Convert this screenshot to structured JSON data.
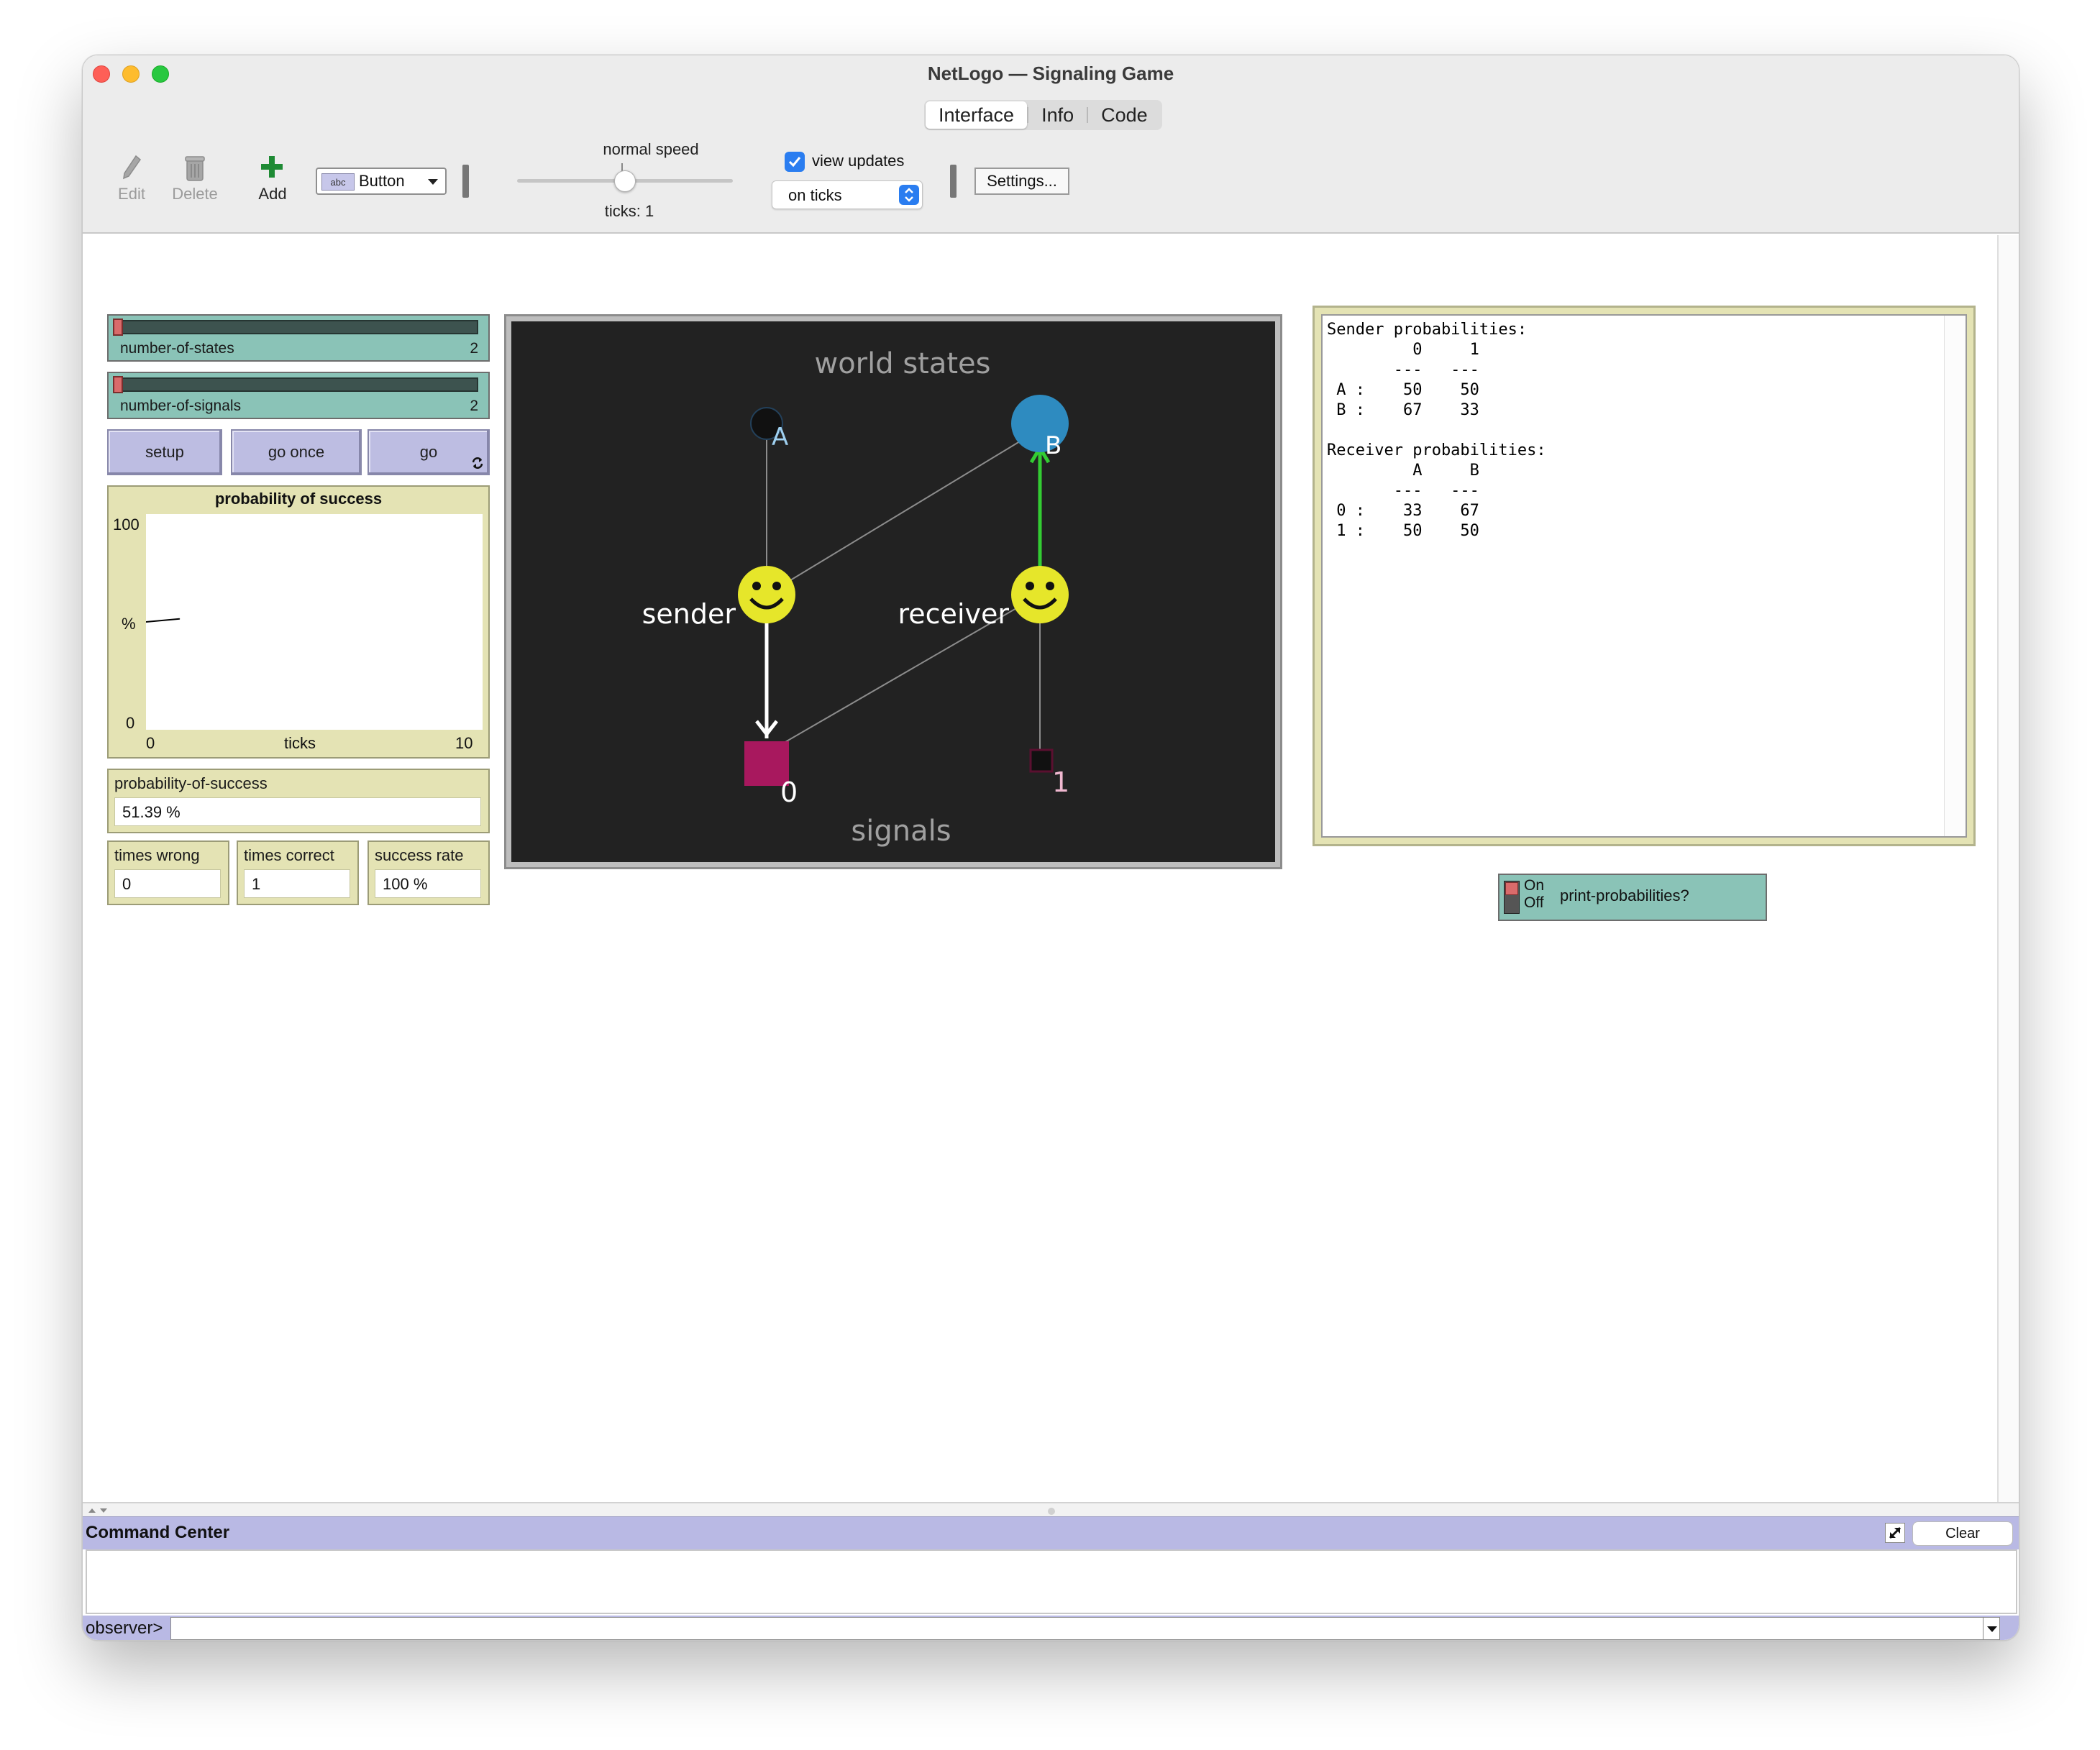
{
  "window": {
    "title": "NetLogo — Signaling Game"
  },
  "tabs": [
    {
      "label": "Interface",
      "active": true
    },
    {
      "label": "Info",
      "active": false
    },
    {
      "label": "Code",
      "active": false
    }
  ],
  "toolbar": {
    "edit": "Edit",
    "delete": "Delete",
    "add": "Add",
    "widget_select": "Button",
    "speed_label": "normal speed",
    "speed_level": 0.5,
    "ticks_text": "ticks: 1",
    "view_updates_label": "view updates",
    "view_updates_checked": true,
    "update_mode": "on ticks",
    "settings": "Settings..."
  },
  "sliders": [
    {
      "label": "number-of-states",
      "value": "2"
    },
    {
      "label": "number-of-signals",
      "value": "2"
    }
  ],
  "buttons": {
    "setup": "setup",
    "go_once": "go once",
    "go": "go"
  },
  "plot": {
    "title": "probability of success",
    "y_max": "100",
    "y_min": "0",
    "y_label": "%",
    "x_min": "0",
    "x_max": "10",
    "x_label": "ticks"
  },
  "chart_data": {
    "type": "line",
    "title": "probability of success",
    "xlabel": "ticks",
    "ylabel": "%",
    "xlim": [
      0,
      10
    ],
    "ylim": [
      0,
      100
    ],
    "x": [
      0,
      1
    ],
    "y": [
      50,
      51.39
    ]
  },
  "monitors": {
    "probability": {
      "label": "probability-of-success",
      "value": "51.39 %"
    },
    "times_wrong": {
      "label": "times wrong",
      "value": "0"
    },
    "times_correct": {
      "label": "times correct",
      "value": "1"
    },
    "success_rate": {
      "label": "success rate",
      "value": "100 %"
    }
  },
  "world": {
    "top_label": "world states",
    "bottom_label": "signals",
    "state_a": "A",
    "state_b": "B",
    "sender": "sender",
    "receiver": "receiver",
    "signal_0": "0",
    "signal_1": "1",
    "colors": {
      "background": "#222222",
      "state_b": "#2e8bc0",
      "agent": "#e6e62a",
      "signal_0": "#a8185e",
      "active_link_green": "#33cc33",
      "active_link_white": "#ffffff"
    }
  },
  "output": {
    "text": "Sender probabilities:\n         0     1\n       ---   ---\n A :    50    50\n B :    67    33\n\nReceiver probabilities:\n         A     B\n       ---   ---\n 0 :    33    67\n 1 :    50    50"
  },
  "switch": {
    "on": "On",
    "off": "Off",
    "label": "print-probabilities?"
  },
  "command_center": {
    "title": "Command Center",
    "clear": "Clear",
    "prompt": "observer>"
  }
}
